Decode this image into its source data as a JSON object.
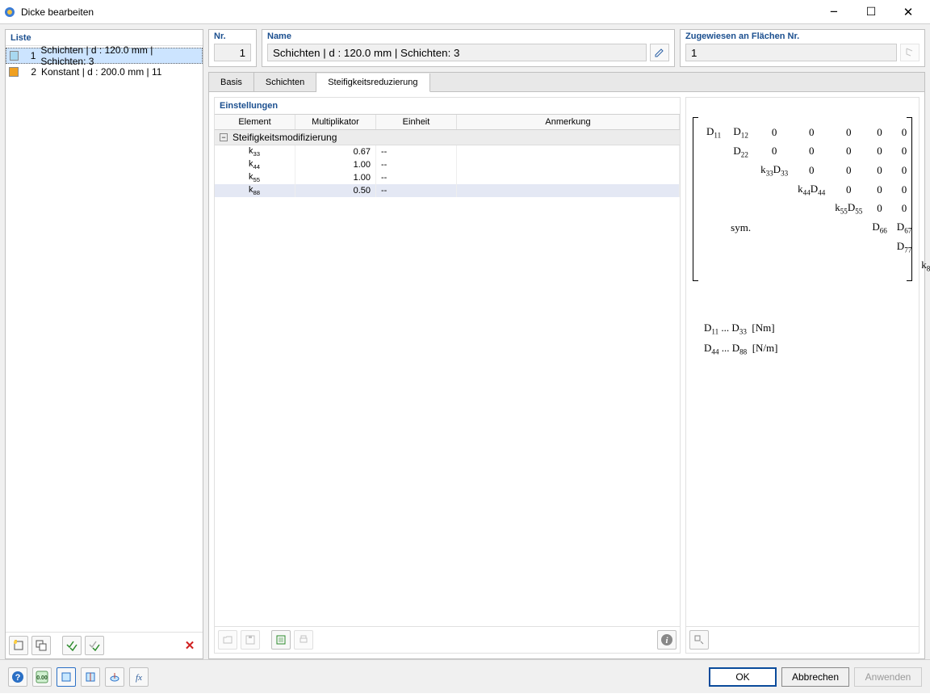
{
  "window": {
    "title": "Dicke bearbeiten"
  },
  "leftPanel": {
    "header": "Liste",
    "items": [
      {
        "num": "1",
        "color": "#a8d8f0",
        "text": "Schichten | d : 120.0 mm | Schichten: 3"
      },
      {
        "num": "2",
        "color": "#f0a020",
        "text": "Konstant | d : 200.0 mm | 11"
      }
    ]
  },
  "fields": {
    "nr": {
      "label": "Nr.",
      "value": "1"
    },
    "name": {
      "label": "Name",
      "value": "Schichten | d : 120.0 mm | Schichten: 3"
    },
    "assigned": {
      "label": "Zugewiesen an Flächen Nr.",
      "value": "1"
    }
  },
  "tabs": {
    "basis": "Basis",
    "schichten": "Schichten",
    "steif": "Steifigkeitsreduzierung"
  },
  "settings": {
    "header": "Einstellungen",
    "columns": {
      "element": "Element",
      "mult": "Multiplikator",
      "unit": "Einheit",
      "note": "Anmerkung"
    },
    "groupLabel": "Steifigkeitsmodifizierung",
    "rows": [
      {
        "element": "k33",
        "mult": "0.67",
        "unit": "--"
      },
      {
        "element": "k44",
        "mult": "1.00",
        "unit": "--"
      },
      {
        "element": "k55",
        "mult": "1.00",
        "unit": "--"
      },
      {
        "element": "k88",
        "mult": "0.50",
        "unit": "--"
      }
    ]
  },
  "units": {
    "line1a": "D",
    "line1b": "11",
    "line1c": " ... D",
    "line1d": "33",
    "line1e": "  [Nm]",
    "line2a": "D",
    "line2b": "44",
    "line2c": " ... D",
    "line2d": "88",
    "line2e": "  [N/m]"
  },
  "buttons": {
    "ok": "OK",
    "cancel": "Abbrechen",
    "apply": "Anwenden"
  }
}
